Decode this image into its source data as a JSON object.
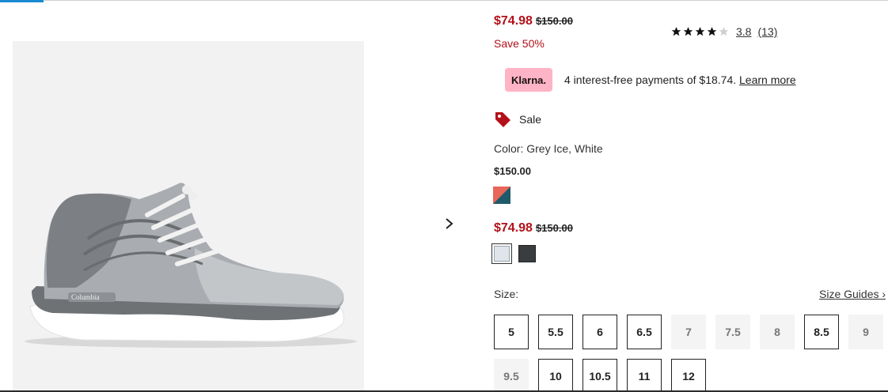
{
  "pricing": {
    "sale_price": "$74.98",
    "original_price": "$150.00",
    "save_text": "Save 50%"
  },
  "rating": {
    "value": "3.8",
    "count": "(13)",
    "stars_filled": 4
  },
  "klarna": {
    "badge": "Klarna.",
    "text": "4 interest-free payments of $18.74.",
    "link": "Learn more"
  },
  "sale_tag": {
    "label": "Sale"
  },
  "color": {
    "label": "Color: Grey Ice, White",
    "swatch_a_price": "$150.00",
    "swatch_b_sale_price": "$74.98",
    "swatch_b_original_price": "$150.00",
    "swatch_a_colors": [
      "#e8675a",
      "#1f5a6b"
    ],
    "swatch_selected_color": "#dfe5ea",
    "swatch_dark_color": "#3a3d40"
  },
  "size": {
    "label": "Size:",
    "guide": "Size Guides ›",
    "options": [
      {
        "label": "5",
        "available": true
      },
      {
        "label": "5.5",
        "available": true
      },
      {
        "label": "6",
        "available": true
      },
      {
        "label": "6.5",
        "available": true
      },
      {
        "label": "7",
        "available": false
      },
      {
        "label": "7.5",
        "available": false
      },
      {
        "label": "8",
        "available": false
      },
      {
        "label": "8.5",
        "available": true
      },
      {
        "label": "9",
        "available": false
      },
      {
        "label": "9.5",
        "available": false
      },
      {
        "label": "10",
        "available": true
      },
      {
        "label": "10.5",
        "available": true
      },
      {
        "label": "11",
        "available": true
      },
      {
        "label": "12",
        "available": true
      }
    ]
  },
  "colors": {
    "sale_red": "#b3111a",
    "klarna_pink": "#ffb3c7",
    "tag_red": "#b3111a"
  }
}
